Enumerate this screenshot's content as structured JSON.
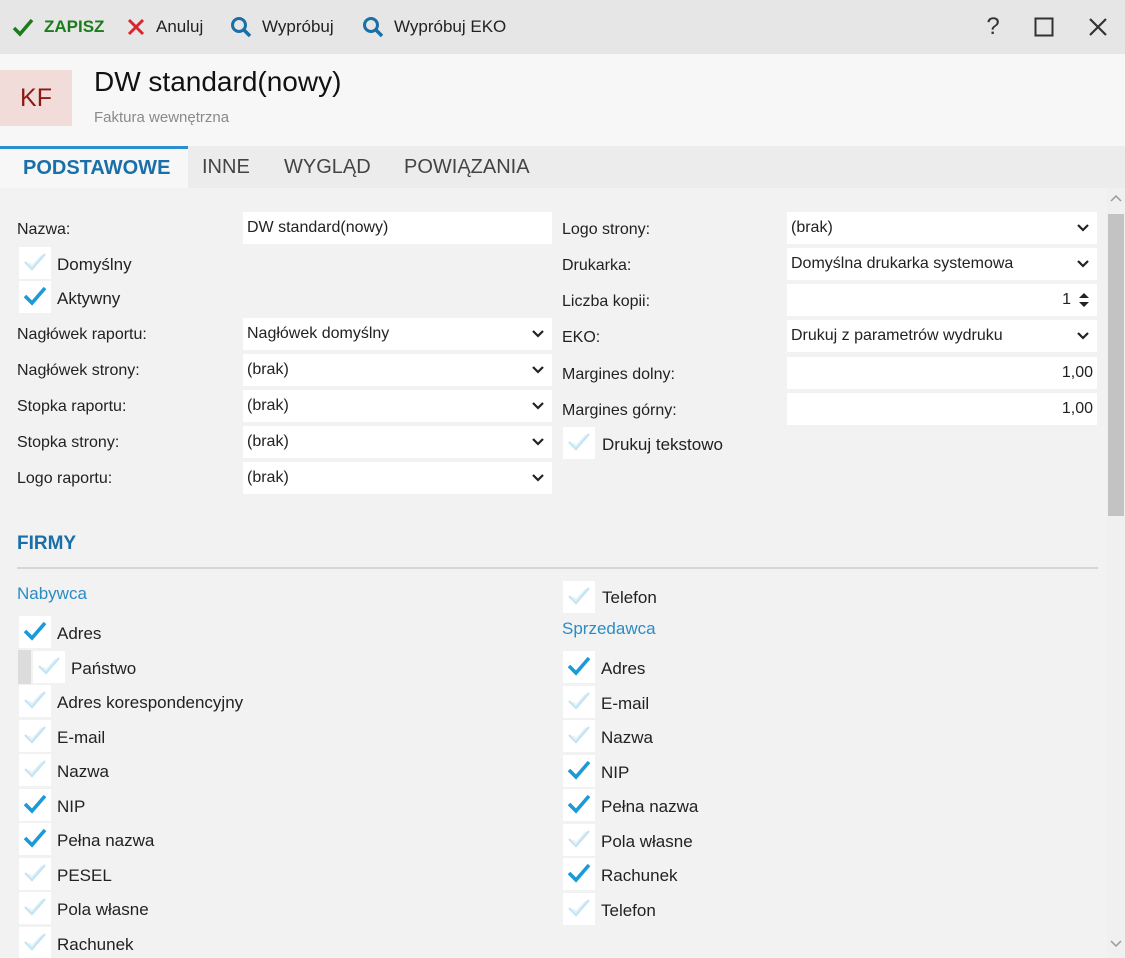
{
  "toolbar": {
    "save": "ZAPISZ",
    "cancel": "Anuluj",
    "try": "Wypróbuj",
    "try_eko": "Wypróbuj EKO"
  },
  "window": {
    "help": "?"
  },
  "header": {
    "badge": "KF",
    "title": "DW standard(nowy)",
    "subtitle": "Faktura wewnętrzna"
  },
  "tabs": [
    "PODSTAWOWE",
    "INNE",
    "WYGLĄD",
    "POWIĄZANIA"
  ],
  "form": {
    "nazwa_label": "Nazwa:",
    "nazwa_value": "DW standard(nowy)",
    "domyslny": {
      "label": "Domyślny",
      "checked": false
    },
    "aktywny": {
      "label": "Aktywny",
      "checked": true
    },
    "naglowek_raportu_label": "Nagłówek raportu:",
    "naglowek_raportu_value": "Nagłówek domyślny",
    "naglowek_strony_label": "Nagłówek strony:",
    "naglowek_strony_value": "(brak)",
    "stopka_raportu_label": "Stopka raportu:",
    "stopka_raportu_value": "(brak)",
    "stopka_strony_label": "Stopka strony:",
    "stopka_strony_value": "(brak)",
    "logo_raportu_label": "Logo raportu:",
    "logo_raportu_value": "(brak)",
    "logo_strony_label": "Logo strony:",
    "logo_strony_value": "(brak)",
    "drukarka_label": "Drukarka:",
    "drukarka_value": "Domyślna drukarka systemowa",
    "kopie_label": "Liczba kopii:",
    "kopie_value": "1",
    "eko_label": "EKO:",
    "eko_value": "Drukuj z parametrów wydruku",
    "margines_dolny_label": "Margines dolny:",
    "margines_dolny_value": "1,00",
    "margines_gorny_label": "Margines górny:",
    "margines_gorny_value": "1,00",
    "drukuj_tekstowo": {
      "label": "Drukuj tekstowo",
      "checked": false
    }
  },
  "firmy": {
    "title": "FIRMY",
    "nabywca": {
      "title": "Nabywca",
      "items": [
        {
          "label": "Adres",
          "checked": true
        },
        {
          "label": "Państwo",
          "checked": false
        },
        {
          "label": "Adres korespondencyjny",
          "checked": false
        },
        {
          "label": "E-mail",
          "checked": false
        },
        {
          "label": "Nazwa",
          "checked": false
        },
        {
          "label": "NIP",
          "checked": true
        },
        {
          "label": "Pełna nazwa",
          "checked": true
        },
        {
          "label": "PESEL",
          "checked": false
        },
        {
          "label": "Pola własne",
          "checked": false
        },
        {
          "label": "Rachunek",
          "checked": false
        }
      ]
    },
    "telefon": {
      "label": "Telefon",
      "checked": false
    },
    "sprzedawca": {
      "title": "Sprzedawca",
      "items": [
        {
          "label": "Adres",
          "checked": true
        },
        {
          "label": "E-mail",
          "checked": false
        },
        {
          "label": "Nazwa",
          "checked": false
        },
        {
          "label": "NIP",
          "checked": true
        },
        {
          "label": "Pełna nazwa",
          "checked": true
        },
        {
          "label": "Pola własne",
          "checked": false
        },
        {
          "label": "Rachunek",
          "checked": true
        },
        {
          "label": "Telefon",
          "checked": false
        }
      ]
    }
  },
  "colors": {
    "check_on": "#1a9ad9",
    "check_off": "#c4e4f3",
    "accent": "#1a6fa8",
    "save": "#1c7c1c",
    "cancel": "#d9262c"
  }
}
